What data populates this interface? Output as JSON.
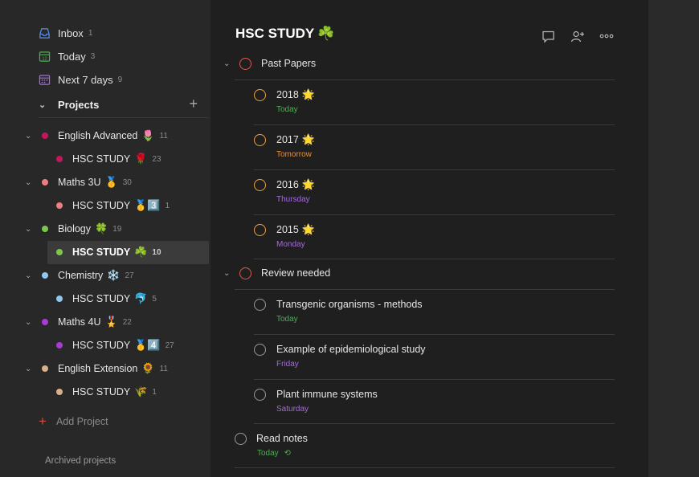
{
  "sidebar": {
    "nav": [
      {
        "label": "Inbox",
        "count": "1"
      },
      {
        "label": "Today",
        "count": "3"
      },
      {
        "label": "Next 7 days",
        "count": "9"
      }
    ],
    "projects_label": "Projects",
    "projects": [
      {
        "label": "English Advanced",
        "emoji": "🌷",
        "count": "11",
        "color": "#c2185b"
      },
      {
        "label": "HSC STUDY",
        "emoji": "🌹",
        "count": "23",
        "color": "#c2185b"
      },
      {
        "label": "Maths 3U",
        "emoji": "🥇",
        "count": "30",
        "color": "#ef7f7f"
      },
      {
        "label": "HSC STUDY",
        "emoji": "🥇3️⃣",
        "count": "1",
        "color": "#ef7f7f"
      },
      {
        "label": "Biology",
        "emoji": "🍀",
        "count": "19",
        "color": "#7cc84a"
      },
      {
        "label": "HSC STUDY",
        "emoji": "☘️",
        "count": "10",
        "color": "#7cc84a"
      },
      {
        "label": "Chemistry",
        "emoji": "❄️",
        "count": "27",
        "color": "#8ec7f0"
      },
      {
        "label": "HSC STUDY",
        "emoji": "🐬",
        "count": "5",
        "color": "#8ec7f0"
      },
      {
        "label": "Maths 4U",
        "emoji": "🎖️",
        "count": "22",
        "color": "#a83bd6"
      },
      {
        "label": "HSC STUDY",
        "emoji": "🥇4️⃣",
        "count": "27",
        "color": "#a83bd6"
      },
      {
        "label": "English Extension",
        "emoji": "🌻",
        "count": "11",
        "color": "#d9b08c"
      },
      {
        "label": "HSC STUDY",
        "emoji": "🌾",
        "count": "1",
        "color": "#d9b08c"
      }
    ],
    "add_project": "Add Project",
    "archived": "Archived projects"
  },
  "main": {
    "title": "HSC STUDY",
    "title_emoji": "☘️",
    "icons": [
      "comment-icon",
      "share-user-icon",
      "more-icon"
    ],
    "sections": [
      {
        "label": "Past Papers",
        "tasks": [
          {
            "label": "2018",
            "emoji": "🌟",
            "due": "Today"
          },
          {
            "label": "2017",
            "emoji": "🌟",
            "due": "Tomorrow"
          },
          {
            "label": "2016",
            "emoji": "🌟",
            "due": "Thursday"
          },
          {
            "label": "2015",
            "emoji": "🌟",
            "due": "Monday"
          }
        ]
      },
      {
        "label": "Review needed",
        "tasks": [
          {
            "label": "Transgenic organisms - methods",
            "due": "Today"
          },
          {
            "label": "Example of epidemiological study",
            "due": "Friday"
          },
          {
            "label": "Plant immune systems",
            "due": "Saturday"
          }
        ]
      }
    ],
    "root_task": {
      "label": "Read notes",
      "due": "Today",
      "recurring_icon": "repeat-icon"
    }
  },
  "colors": {
    "today": "#4caf50",
    "tomorrow": "#ef8c2a",
    "weekday": "#a46bdc",
    "accent": "#e05a4a"
  }
}
